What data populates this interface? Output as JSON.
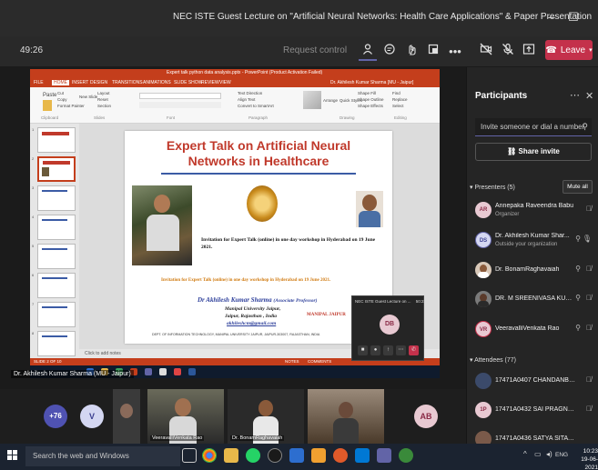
{
  "window": {
    "title": "NEC ISTE Guest Lecture on \"Artificial Neural Networks: Health Care Applications\" & Paper Presentation",
    "minimize": "–",
    "maximize": "☐",
    "close": "✕"
  },
  "toolbar": {
    "timer": "49:26",
    "request_control": "Request control",
    "leave_label": "Leave",
    "icons": [
      "participants-icon",
      "chat-icon",
      "reactions-icon",
      "rooms-icon",
      "more-icon",
      "camera-off-icon",
      "mic-off-icon",
      "share-icon"
    ]
  },
  "powerpoint": {
    "window_title": "Expert talk python data analysis.pptx - PowerPoint (Product Activation Failed)",
    "tabs": [
      "FILE",
      "HOME",
      "INSERT",
      "DESIGN",
      "TRANSITIONS",
      "ANIMATIONS",
      "SLIDE SHOW",
      "REVIEW",
      "VIEW"
    ],
    "user": "Dr. Akhilesh Kumar Sharma [MU - Jaipur]",
    "ribbon_groups": [
      "Clipboard",
      "Slides",
      "Font",
      "Paragraph",
      "Drawing",
      "Editing"
    ],
    "ribbon_items": [
      "Cut",
      "Copy",
      "Format Painter",
      "Paste",
      "New Slide",
      "Layout",
      "Reset",
      "Section",
      "Text Direction",
      "Align Text",
      "Convert to SmartArt",
      "Arrange",
      "Quick Styles",
      "Shape Fill",
      "Shape Outline",
      "Shape Effects",
      "Find",
      "Replace",
      "Select"
    ],
    "thumb_numbers": [
      "1",
      "2",
      "3",
      "4",
      "5",
      "6",
      "7",
      "8"
    ],
    "notes": "Click to add notes",
    "status_left": "SLIDE 2 OF 10",
    "status_right": [
      "NOTES",
      "COMMENTS"
    ]
  },
  "slide": {
    "heading_line1": "Expert Talk on Artificial Neural",
    "heading_line2": "Networks in Healthcare",
    "invite_text": "Invitation for Expert Talk (online) in one day workshop in Hyderabad on 19 June 2021.",
    "invite_orange": "Invitation for Expert Talk (online) in one day workshop in Hyderabad on 19 June 2021.",
    "speaker_name": "Dr Akhilesh Kumar Sharma",
    "speaker_role": "(Associate Professor)",
    "speaker_univ": "Manipal University Jaipur,",
    "speaker_place": "Jaipur, Rajasthan , India",
    "speaker_email": "akhileshcm@gmail.com",
    "manipal": "MANIPAL JAIPUR",
    "address": "DEPT. OF INFORMATION TECHNOLOGY, MANIPAL UNIVERSITY JAIPUR, JAIPUR-303007, RAJASTHAN, INDIA"
  },
  "mini_window": {
    "title": "NEC ISTE Guest Lecture on ...",
    "timer": "50:22",
    "avatar": "DB"
  },
  "presenter_label": "Dr. Akhilesh Kumar Sharma (MU - Jaipur)",
  "strip": {
    "overflow": "+76",
    "avatar_v": "V",
    "tile1": "VeeravalliVenkata Rao",
    "tile2": "Dr. BonamRaghavaiah",
    "tile3": "",
    "avatar_ab": "AB"
  },
  "panel": {
    "title": "Participants",
    "invite_placeholder": "Invite someone or dial a number",
    "share_invite": "Share invite",
    "presenters_label": "Presenters (5)",
    "mute_all": "Mute all",
    "presenters": [
      {
        "initials": "AR",
        "name": "Annepaka Raveendra Babu",
        "sub": "Organizer",
        "color": "#e8c9d2",
        "text": "#8a2a46"
      },
      {
        "initials": "DS",
        "name": "Dr. Akhilesh Kumar Shar...",
        "sub": "Outside your organization",
        "color": "#d4d7f2",
        "text": "#3b3f8f"
      },
      {
        "initials": "",
        "name": "Dr. BonamRaghavaiah",
        "sub": "",
        "color": "#8a5a3a",
        "text": "#fff"
      },
      {
        "initials": "",
        "name": "DR. M SREENIVASA KUM...",
        "sub": "",
        "color": "#6b6b6b",
        "text": "#fff"
      },
      {
        "initials": "VR",
        "name": "VeeravalliVenkata Rao",
        "sub": "",
        "color": "#e8c9d2",
        "text": "#8a2a46"
      }
    ],
    "attendees_label": "Attendees (77)",
    "attendees": [
      {
        "initials": "",
        "name": "17471A0407 CHANDANBATT...",
        "color": "#3b4a6a"
      },
      {
        "initials": "1P",
        "name": "17471A0432 SAI PRAGNACH...",
        "color": "#e8c9d2"
      },
      {
        "initials": "",
        "name": "17471A0436 SATYA SITA RAM...",
        "color": "#7a5a4a"
      }
    ]
  },
  "windows": {
    "search": "Search the web and Windows",
    "lang": "ENG",
    "time": "10:23",
    "date": "19-06-2021"
  }
}
